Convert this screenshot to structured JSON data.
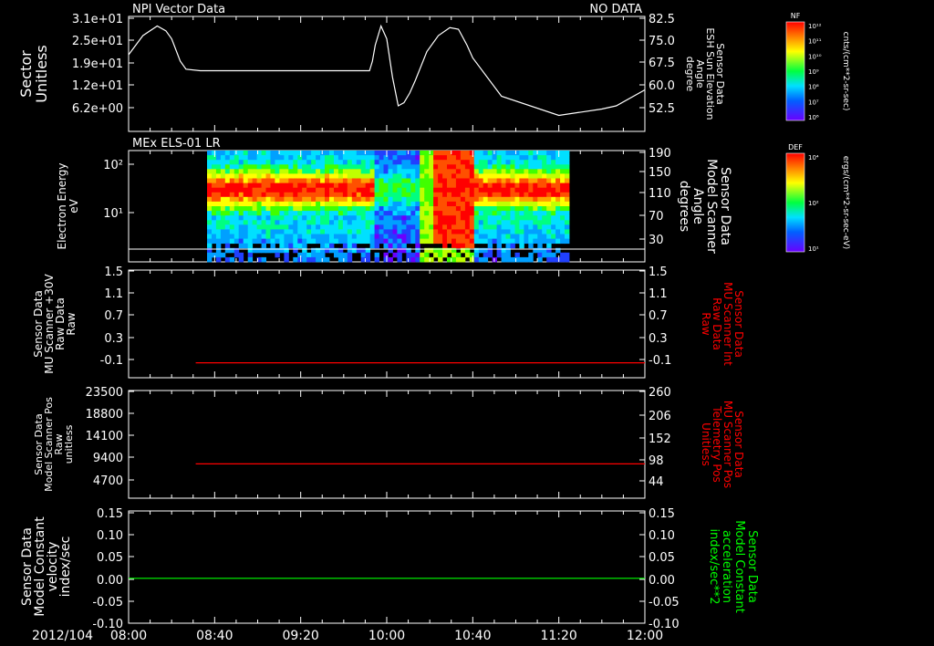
{
  "chart_data": [
    {
      "type": "line",
      "title_left": "NPI Vector Data",
      "title_right": "NO DATA",
      "left_label": [
        "Sector",
        "Unitless"
      ],
      "right_label": [
        "Sensor Data",
        "ESH Sun Elevation",
        "Angle",
        "degree"
      ],
      "left_ticks": [
        "3.1e+01",
        "2.5e+01",
        "1.9e+01",
        "1.2e+01",
        "6.2e+00"
      ],
      "right_ticks": [
        "82.5",
        "75.0",
        "67.5",
        "60.0",
        "52.5"
      ],
      "ylim": [
        47,
        83
      ],
      "series": [
        {
          "x": [
            0,
            5,
            10,
            13,
            15,
            18,
            20,
            25,
            30,
            35,
            40,
            42,
            44,
            46,
            48,
            50,
            52,
            54,
            56,
            58,
            60,
            62,
            64,
            66,
            68,
            70,
            72,
            74,
            76,
            78,
            80,
            82,
            84,
            85,
            86,
            88,
            90,
            92,
            94,
            96,
            98,
            100,
            104,
            108,
            112,
            115,
            118,
            120,
            130,
            150,
            165,
            170,
            180
          ],
          "y": [
            71,
            77,
            80,
            78.5,
            76,
            69,
            66.5,
            66,
            66,
            66,
            66,
            66,
            66,
            66,
            66,
            66,
            66,
            66,
            66,
            66,
            66,
            66,
            66,
            66,
            66,
            66,
            66,
            66,
            66,
            66,
            66,
            66,
            66,
            69,
            74,
            80,
            76,
            64,
            55,
            56,
            59,
            63,
            72,
            77,
            79.5,
            79,
            74,
            70,
            58,
            52,
            54,
            55,
            60
          ]
        }
      ]
    },
    {
      "type": "heatmap",
      "title_left": "MEx ELS-01 LR",
      "left_label": [
        "Electron Energy",
        "eV"
      ],
      "right_label": [
        "Sensor Data",
        "Model Scanner",
        "Angle",
        "degrees"
      ],
      "left_ticks": [
        "10²",
        "10¹"
      ],
      "right_ticks": [
        "190",
        "150",
        "110",
        "70",
        "30"
      ]
    },
    {
      "type": "line",
      "left_label": [
        "Sensor Data",
        "MU Scanner +30V",
        "Raw Data",
        "Raw"
      ],
      "right_label": [
        "Sensor Data",
        "MU Scanner Int",
        "Raw Data",
        "Raw"
      ],
      "left_ticks": [
        "1.5",
        "1.1",
        "0.7",
        "0.3",
        "-0.1"
      ],
      "right_ticks": [
        "1.5",
        "1.1",
        "0.7",
        "0.3",
        "-0.1"
      ],
      "ylim": [
        -0.3,
        1.5
      ],
      "series": [
        {
          "x": [
            40,
            300
          ],
          "y": [
            -0.05,
            -0.05
          ]
        }
      ]
    },
    {
      "type": "line",
      "left_label": [
        "Sensor Data",
        "Model Scanner Pos",
        "Raw",
        "unitless"
      ],
      "right_label": [
        "Sensor Data",
        "MU Scanner Pos",
        "Telemetry Pos",
        "Unitless"
      ],
      "left_ticks": [
        "23500",
        "18800",
        "14100",
        "9400",
        "4700"
      ],
      "right_ticks": [
        "260",
        "206",
        "152",
        "98",
        "44"
      ],
      "ylim": [
        0,
        23500
      ],
      "series": [
        {
          "x": [
            40,
            300
          ],
          "y": [
            7500,
            7500
          ]
        }
      ]
    },
    {
      "type": "line",
      "left_label": [
        "Sensor Data",
        "Model Constant",
        "velocity",
        "index/sec"
      ],
      "right_label": [
        "Sensor Data",
        "Model Constant",
        "acceleration",
        "index/sec**2"
      ],
      "left_ticks": [
        "0.15",
        "0.10",
        "0.05",
        "0.00",
        "-0.05",
        "-0.10"
      ],
      "right_ticks": [
        "0.15",
        "0.10",
        "0.05",
        "0.00",
        "-0.05",
        "-0.10"
      ],
      "ylim": [
        -0.1,
        0.15
      ],
      "series": [
        {
          "x": [
            0,
            300
          ],
          "y": [
            0,
            0
          ]
        }
      ]
    }
  ],
  "x_axis": {
    "date": "2012/104",
    "ticks": [
      "08:00",
      "08:40",
      "09:20",
      "10:00",
      "10:40",
      "11:20",
      "12:00"
    ],
    "range_minutes": [
      0,
      240
    ]
  },
  "colorbars": [
    {
      "label": "NF",
      "units": "cnts/(cm**2-sr-sec)",
      "ticks": [
        "10¹²",
        "10¹¹",
        "10¹⁰",
        "10⁹",
        "10⁸",
        "10⁷",
        "10⁶"
      ]
    },
    {
      "label": "DEF",
      "units": "ergs/(cm**2-sr-sec-eV)",
      "ticks": [
        "10⁴",
        "10²",
        "10¹"
      ]
    }
  ],
  "colors": {
    "panel1_line": "#ffffff",
    "panel3_line": "#ff0000",
    "panel4_line": "#ff0000",
    "panel5_line": "#00ff00",
    "red_label": "#ff0000",
    "green_label": "#00ff00"
  }
}
